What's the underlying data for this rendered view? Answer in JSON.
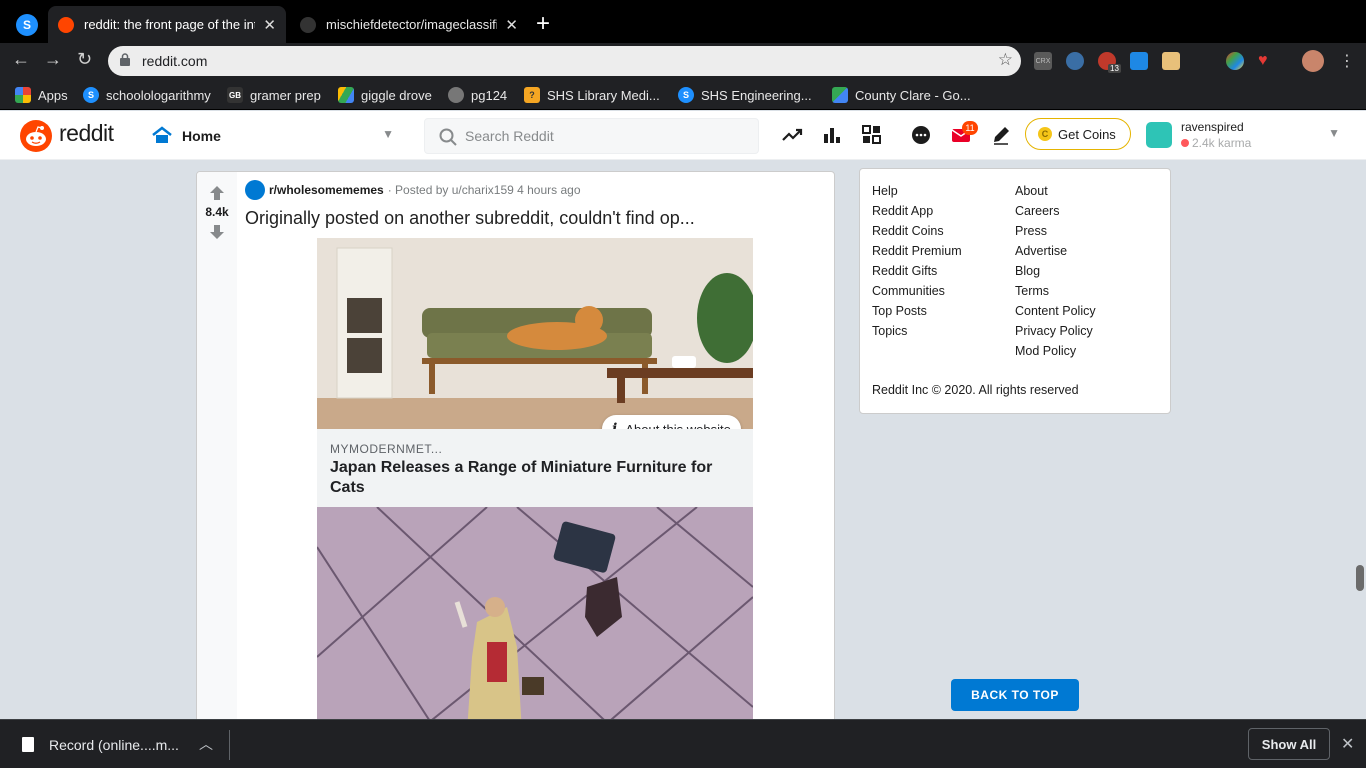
{
  "browser": {
    "tabs": [
      {
        "title": "reddit: the front page of the int",
        "active": true
      },
      {
        "title": "mischiefdetector/imageclassifi",
        "active": false
      }
    ],
    "new_tab": "+",
    "url": "reddit.com",
    "extensions": [
      {
        "name": "crx-icon",
        "text": "CRX"
      },
      {
        "name": "owl-extension-icon",
        "text": ""
      },
      {
        "name": "adblock-extension-icon",
        "text": "ABP",
        "badge": "13"
      },
      {
        "name": "check-extension-icon",
        "text": ""
      },
      {
        "name": "box-extension-icon",
        "text": ""
      },
      {
        "name": "color-extension-icon",
        "text": ""
      },
      {
        "name": "heart-extension-icon",
        "text": ""
      }
    ],
    "bookmarks": [
      {
        "label": "Apps",
        "icon": "apps-grid-icon"
      },
      {
        "label": "schoolologarithmy",
        "icon": "schoology-icon"
      },
      {
        "label": "gramer prep",
        "icon": "gb-icon"
      },
      {
        "label": "giggle drove",
        "icon": "drive-icon"
      },
      {
        "label": "pg124",
        "icon": "globe-icon"
      },
      {
        "label": "SHS Library Medi...",
        "icon": "library-icon"
      },
      {
        "label": "SHS Engineering...",
        "icon": "schoology-icon"
      },
      {
        "label": "County Clare - Go...",
        "icon": "maps-icon"
      }
    ]
  },
  "reddit": {
    "wordmark": "reddit",
    "home_label": "Home",
    "search_placeholder": "Search Reddit",
    "mail_badge": "11",
    "get_coins": "Get Coins",
    "username": "ravenspired",
    "karma": "2.4k karma",
    "colors": {
      "brand": "#FF4500",
      "accent": "#0079D3",
      "bg": "#DAE0E6"
    }
  },
  "post": {
    "score": "8.4k",
    "subreddit": "r/wholesomememes",
    "posted_by": "· Posted by u/charix159 4 hours ago",
    "title": "Originally posted on another subreddit, couldn't find op...",
    "about_website": "About this website",
    "link_site": "MYMODERNMET...",
    "link_title": "Japan Releases a Range of Miniature Furniture for Cats"
  },
  "sidebar": {
    "col1": [
      "Help",
      "Reddit App",
      "Reddit Coins",
      "Reddit Premium",
      "Reddit Gifts",
      "Communities",
      "Top Posts",
      "Topics"
    ],
    "col2": [
      "About",
      "Careers",
      "Press",
      "Advertise",
      "Blog",
      "Terms",
      "Content Policy",
      "Privacy Policy",
      "Mod Policy"
    ],
    "copyright": "Reddit Inc © 2020. All rights reserved",
    "back_to_top": "BACK TO TOP"
  },
  "downloads": {
    "file": "Record (online....m...",
    "show_all": "Show All"
  }
}
